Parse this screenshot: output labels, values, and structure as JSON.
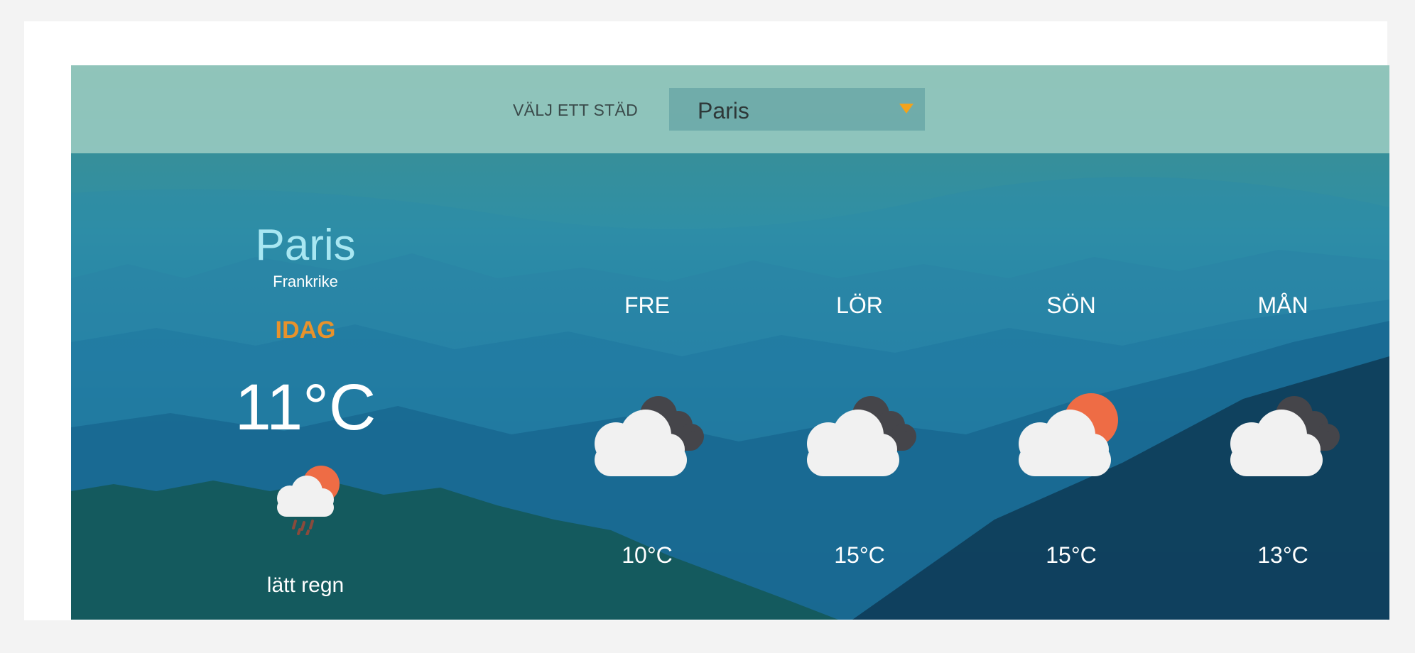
{
  "header": {
    "city_label": "VÄLJ ETT STÄD",
    "selected_city": "Paris"
  },
  "today": {
    "city": "Paris",
    "country": "Frankrike",
    "label": "IDAG",
    "temperature": "11°C",
    "description": "lätt regn",
    "icon": "light-rain-sun-icon"
  },
  "forecast": [
    {
      "day": "FRE",
      "temperature": "10°C",
      "icon": "cloud-dark-cloud-icon"
    },
    {
      "day": "LÖR",
      "temperature": "15°C",
      "icon": "cloud-dark-cloud-icon"
    },
    {
      "day": "SÖN",
      "temperature": "15°C",
      "icon": "cloud-sun-icon"
    },
    {
      "day": "MÅN",
      "temperature": "13°C",
      "icon": "cloud-dark-cloud-icon"
    }
  ],
  "colors": {
    "accent": "#e8922b",
    "city_name": "#a8e7f2",
    "caret": "#f2a31b",
    "sun": "#ee6c45",
    "dark_cloud": "#45454a",
    "cloud": "#f1f1f1"
  }
}
